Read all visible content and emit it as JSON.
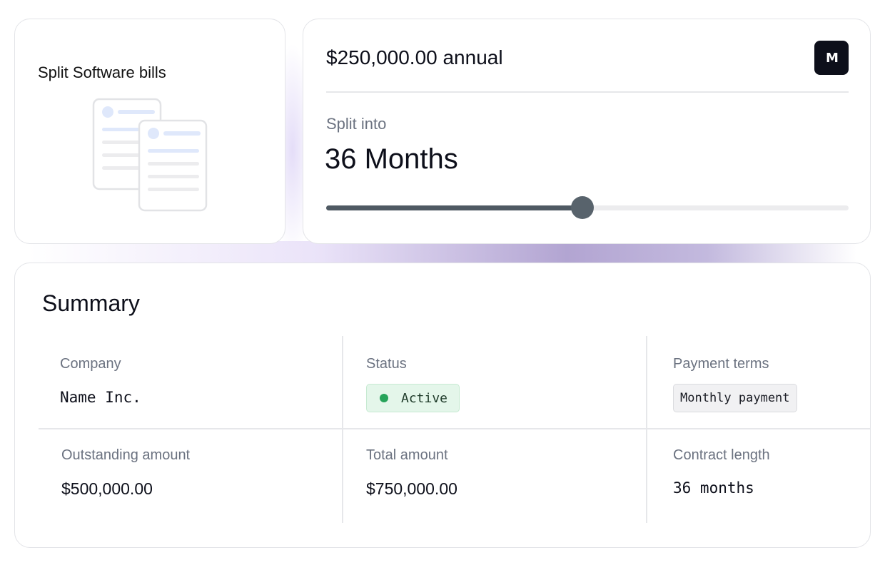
{
  "split_card": {
    "title": "Split Software bills",
    "illustration_icon": "documents-icon"
  },
  "amount_card": {
    "amount": "$250,000.00 annual",
    "logo_text": "M",
    "split_label": "Split into",
    "split_value": "36 Months",
    "slider_fraction": 0.49
  },
  "summary": {
    "title": "Summary",
    "company_label": "Company",
    "company_value": "Name Inc.",
    "status_label": "Status",
    "status_value": "Active",
    "status_color": "#27a35a",
    "terms_label": "Payment terms",
    "terms_value": "Monthly payment",
    "outstanding_label": "Outstanding amount",
    "outstanding_value": "$500,000.00",
    "total_label": "Total amount",
    "total_value": "$750,000.00",
    "contract_label": "Contract length",
    "contract_value": "36 months"
  }
}
